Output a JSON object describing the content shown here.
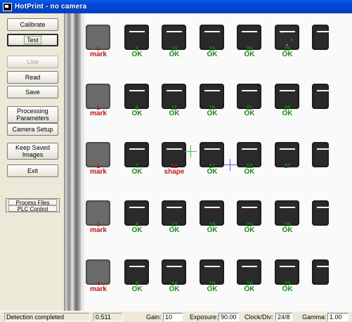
{
  "window": {
    "title": "HotPrint - no camera"
  },
  "buttons": {
    "calibrate": "Calibrate",
    "test": "Test",
    "live": "Live",
    "read": "Read",
    "save": "Save",
    "processing_parameters": "Processing Parameters",
    "camera_setup": "Camera Setup",
    "keep_saved_images": "Keep Saved Images",
    "exit": "Exit"
  },
  "mode": {
    "process_files": "Process Files",
    "plc_control": "PLC Control"
  },
  "grid": {
    "rows": [
      {
        "labels": [
          {
            "num": "0",
            "text": "mark",
            "status": "bad"
          },
          {
            "num": "5",
            "text": "OK",
            "status": "ok"
          },
          {
            "num": "10",
            "text": "OK",
            "status": "ok"
          },
          {
            "num": "15",
            "text": "OK",
            "status": "ok"
          },
          {
            "num": "20",
            "text": "OK",
            "status": "ok"
          },
          {
            "num": "25",
            "text": "OK",
            "status": "ok"
          }
        ]
      },
      {
        "labels": [
          {
            "num": "1",
            "text": "mark",
            "status": "bad"
          },
          {
            "num": "6",
            "text": "OK",
            "status": "ok"
          },
          {
            "num": "11",
            "text": "OK",
            "status": "ok"
          },
          {
            "num": "16",
            "text": "OK",
            "status": "ok"
          },
          {
            "num": "21",
            "text": "OK",
            "status": "ok"
          },
          {
            "num": "26",
            "text": "OK",
            "status": "ok"
          }
        ]
      },
      {
        "labels": [
          {
            "num": "2",
            "text": "mark",
            "status": "bad"
          },
          {
            "num": "7",
            "text": "OK",
            "status": "ok"
          },
          {
            "num": "12",
            "text": "shape",
            "status": "bad"
          },
          {
            "num": "17",
            "text": "OK",
            "status": "ok"
          },
          {
            "num": "22",
            "text": "OK",
            "status": "ok"
          },
          {
            "num": "27",
            "text": "",
            "status": "ok"
          }
        ]
      },
      {
        "labels": [
          {
            "num": "3",
            "text": "mark",
            "status": "bad"
          },
          {
            "num": "8",
            "text": "OK",
            "status": "ok"
          },
          {
            "num": "13",
            "text": "OK",
            "status": "ok"
          },
          {
            "num": "18",
            "text": "OK",
            "status": "ok"
          },
          {
            "num": "23",
            "text": "OK",
            "status": "ok"
          },
          {
            "num": "28",
            "text": "OK",
            "status": "ok"
          }
        ]
      },
      {
        "labels": [
          {
            "num": "4",
            "text": "mark",
            "status": "bad"
          },
          {
            "num": "9",
            "text": "OK",
            "status": "ok"
          },
          {
            "num": "14",
            "text": "OK",
            "status": "ok"
          },
          {
            "num": "19",
            "text": "OK",
            "status": "ok"
          },
          {
            "num": "24",
            "text": "OK",
            "status": "ok"
          },
          {
            "num": "29",
            "text": "OK",
            "status": "ok"
          }
        ]
      }
    ]
  },
  "status": {
    "message": "Detection completed",
    "value": "0.511",
    "gain_label": "Gain:",
    "gain": "10",
    "exposure_label": "Exposure:",
    "exposure": "90.00",
    "clock_label": "Clock/Div:",
    "clock": "24/8",
    "gamma_label": "Gamma:",
    "gamma": "1.00"
  },
  "colors": {
    "ok": "#1a8a1a",
    "bad": "#c01818",
    "titlebar": "#0046d5"
  }
}
